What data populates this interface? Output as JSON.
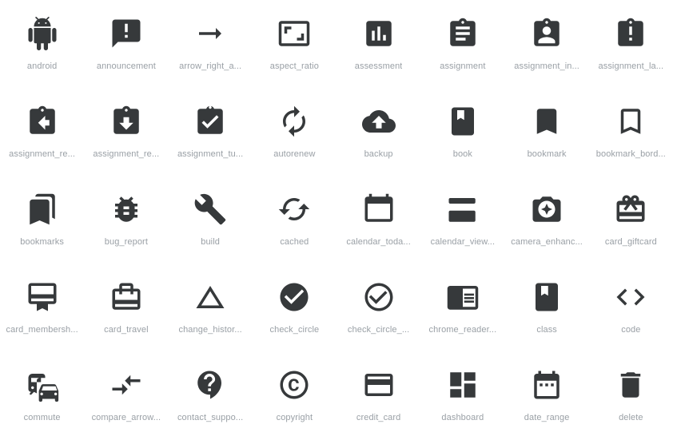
{
  "gallery": {
    "columns": 8,
    "rows": 5,
    "background_color": "#ffffff",
    "icon_color": "#36393b",
    "label_color": "#9aa0a6",
    "icons": [
      {
        "name": "android",
        "label": "android",
        "glyph": "android-icon"
      },
      {
        "name": "announcement",
        "label": "announcement",
        "glyph": "announcement-icon"
      },
      {
        "name": "arrow_right_alt",
        "label": "arrow_right_a...",
        "glyph": "arrow-right-alt-icon"
      },
      {
        "name": "aspect_ratio",
        "label": "aspect_ratio",
        "glyph": "aspect-ratio-icon"
      },
      {
        "name": "assessment",
        "label": "assessment",
        "glyph": "assessment-icon"
      },
      {
        "name": "assignment",
        "label": "assignment",
        "glyph": "assignment-icon"
      },
      {
        "name": "assignment_ind",
        "label": "assignment_in...",
        "glyph": "assignment-ind-icon"
      },
      {
        "name": "assignment_late",
        "label": "assignment_la...",
        "glyph": "assignment-late-icon"
      },
      {
        "name": "assignment_return",
        "label": "assignment_re...",
        "glyph": "assignment-return-icon"
      },
      {
        "name": "assignment_returned",
        "label": "assignment_re...",
        "glyph": "assignment-returned-icon"
      },
      {
        "name": "assignment_turned_in",
        "label": "assignment_tu...",
        "glyph": "assignment-turned-in-icon"
      },
      {
        "name": "autorenew",
        "label": "autorenew",
        "glyph": "autorenew-icon"
      },
      {
        "name": "backup",
        "label": "backup",
        "glyph": "backup-icon"
      },
      {
        "name": "book",
        "label": "book",
        "glyph": "book-icon"
      },
      {
        "name": "bookmark",
        "label": "bookmark",
        "glyph": "bookmark-icon"
      },
      {
        "name": "bookmark_border",
        "label": "bookmark_bord...",
        "glyph": "bookmark-border-icon"
      },
      {
        "name": "bookmarks",
        "label": "bookmarks",
        "glyph": "bookmarks-icon"
      },
      {
        "name": "bug_report",
        "label": "bug_report",
        "glyph": "bug-report-icon"
      },
      {
        "name": "build",
        "label": "build",
        "glyph": "build-icon"
      },
      {
        "name": "cached",
        "label": "cached",
        "glyph": "cached-icon"
      },
      {
        "name": "calendar_today",
        "label": "calendar_toda...",
        "glyph": "calendar-today-icon"
      },
      {
        "name": "calendar_view_day",
        "label": "calendar_view...",
        "glyph": "calendar-view-day-icon"
      },
      {
        "name": "camera_enhance",
        "label": "camera_enhanc...",
        "glyph": "camera-enhance-icon"
      },
      {
        "name": "card_giftcard",
        "label": "card_giftcard",
        "glyph": "card-giftcard-icon"
      },
      {
        "name": "card_membership",
        "label": "card_membersh...",
        "glyph": "card-membership-icon"
      },
      {
        "name": "card_travel",
        "label": "card_travel",
        "glyph": "card-travel-icon"
      },
      {
        "name": "change_history",
        "label": "change_histor...",
        "glyph": "change-history-icon"
      },
      {
        "name": "check_circle",
        "label": "check_circle",
        "glyph": "check-circle-icon"
      },
      {
        "name": "check_circle_outline",
        "label": "check_circle_...",
        "glyph": "check-circle-outline-icon"
      },
      {
        "name": "chrome_reader_mode",
        "label": "chrome_reader...",
        "glyph": "chrome-reader-mode-icon"
      },
      {
        "name": "class",
        "label": "class",
        "glyph": "class-icon"
      },
      {
        "name": "code",
        "label": "code",
        "glyph": "code-icon"
      },
      {
        "name": "commute",
        "label": "commute",
        "glyph": "commute-icon"
      },
      {
        "name": "compare_arrows",
        "label": "compare_arrow...",
        "glyph": "compare-arrows-icon"
      },
      {
        "name": "contact_support",
        "label": "contact_suppo...",
        "glyph": "contact-support-icon"
      },
      {
        "name": "copyright",
        "label": "copyright",
        "glyph": "copyright-icon"
      },
      {
        "name": "credit_card",
        "label": "credit_card",
        "glyph": "credit-card-icon"
      },
      {
        "name": "dashboard",
        "label": "dashboard",
        "glyph": "dashboard-icon"
      },
      {
        "name": "date_range",
        "label": "date_range",
        "glyph": "date-range-icon"
      },
      {
        "name": "delete",
        "label": "delete",
        "glyph": "delete-icon"
      }
    ]
  }
}
